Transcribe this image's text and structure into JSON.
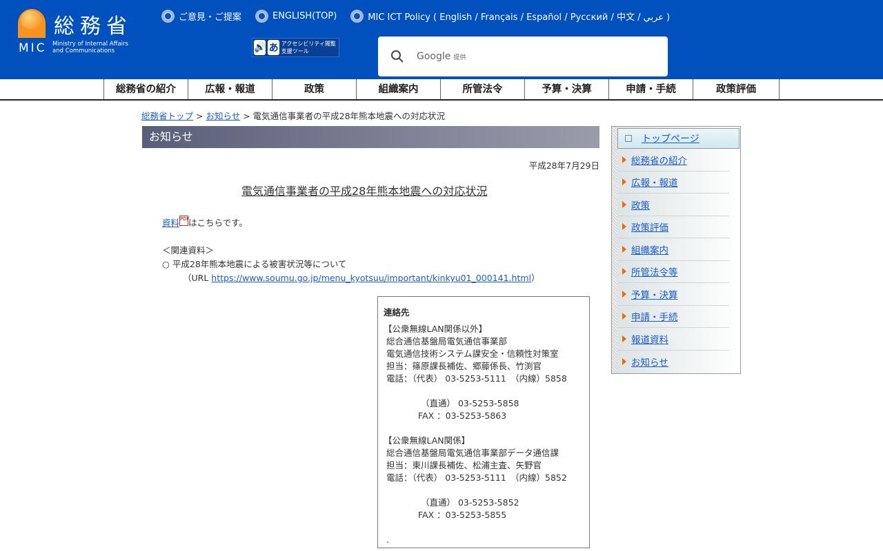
{
  "header": {
    "logo_jp": "総務省",
    "logo_abbr": "MIC",
    "logo_en1": "Ministry of Internal Affairs",
    "logo_en2": "and Communications",
    "links": [
      "ご意見・ご提案",
      "ENGLISH(TOP)",
      "MIC ICT Policy ( English / Français / Español / Русский / 中文 / عربي )"
    ],
    "accessibility_label": "アクセシビリティ閲覧支援ツール",
    "search_brand": "Google",
    "search_suffix": "提供"
  },
  "nav": [
    "総務省の紹介",
    "広報・報道",
    "政策",
    "組織案内",
    "所管法令",
    "予算・決算",
    "申請・手続",
    "政策評価"
  ],
  "breadcrumb": {
    "home": "総務省トップ",
    "sep": " > ",
    "news": "お知らせ",
    "current": "電気通信事業者の平成28年熊本地震への対応状況"
  },
  "main": {
    "section_title": "お知らせ",
    "date": "平成28年7月29日",
    "title": "電気通信事業者の平成28年熊本地震への対応状況",
    "material_link": "資料",
    "material_text": "はこちらです。",
    "related_heading": "＜関連資料＞",
    "related_item": "○ 平成28年熊本地震による被害状況等について",
    "url_prefix": "（URL ",
    "url": "https://www.soumu.go.jp/menu_kyotsuu/important/kinkyu01_000141.html",
    "url_suffix": "）"
  },
  "contact": {
    "title": "連絡先",
    "lines": [
      "【公衆無線LAN関係以外】",
      " 総合通信基盤局電気通信事業部",
      " 電気通信技術システム課安全・信頼性対策室",
      " 担当：篠原課長補佐、郷藤係長、竹渕官",
      " 電話：（代表） 03-5253-5111　（内線）5858",
      "",
      "　　　　 （直通） 03-5253-5858",
      "　　　　FAX ：03-5253-5863",
      "",
      "【公衆無線LAN関係】",
      " 総合通信基盤局電気通信事業部データ通信課",
      " 担当：東川課長補佐、松浦主査、矢野官",
      " 電話：（代表） 03-5253-5111　（内線）5852",
      "",
      "　　　　 （直通） 03-5253-5852",
      "　　　　FAX ：03-5253-5855",
      "",
      " ."
    ]
  },
  "sidebar": {
    "top": "トップページ",
    "items": [
      "総務省の紹介",
      "広報・報道",
      "政策",
      "政策評価",
      "組織案内",
      "所管法令等",
      "予算・決算",
      "申請・手続",
      "報道資料",
      "お知らせ"
    ]
  },
  "colors": {
    "header_bg": "#0050be",
    "accent": "#f06a00"
  }
}
